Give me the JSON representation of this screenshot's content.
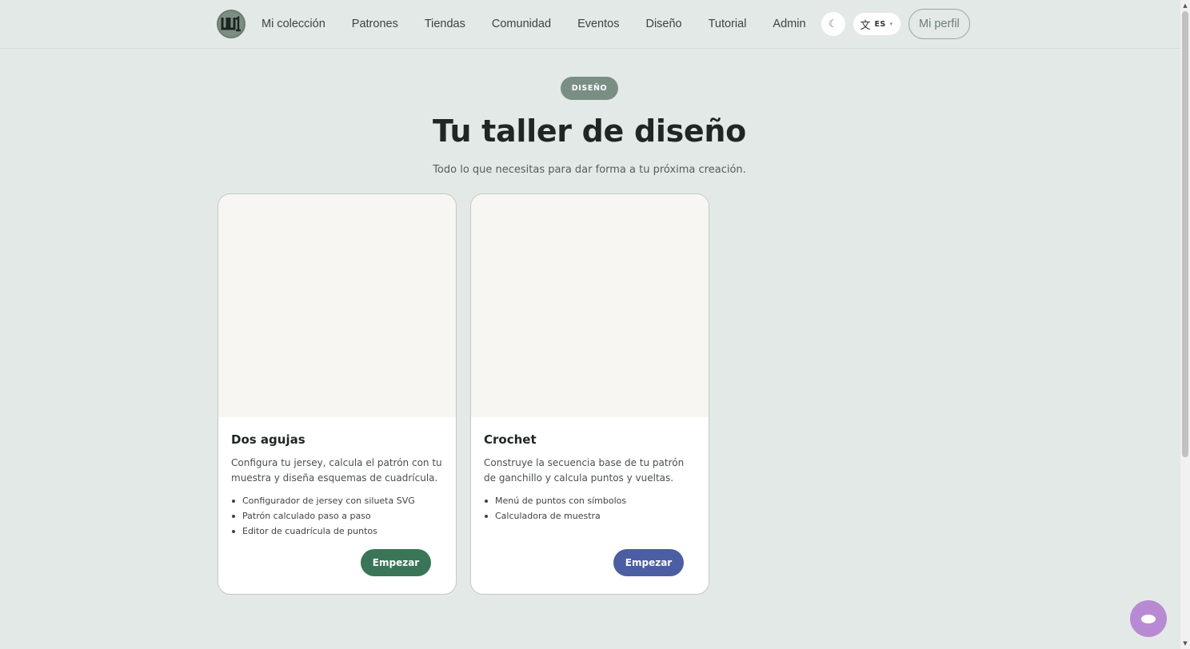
{
  "header": {
    "logo_icon": "yarn-logo-icon",
    "nav": [
      {
        "label": "Mi colección"
      },
      {
        "label": "Patrones"
      },
      {
        "label": "Tiendas"
      },
      {
        "label": "Comunidad"
      },
      {
        "label": "Eventos"
      },
      {
        "label": "Diseño"
      },
      {
        "label": "Tutorial"
      },
      {
        "label": "Admin"
      }
    ],
    "theme_icon": "moon-icon",
    "theme_glyph": "☾",
    "language": {
      "globe_glyph": "文",
      "code": "ES",
      "caret": "▾"
    },
    "profile_label": "Mi perfil"
  },
  "hero": {
    "badge": "DISEÑO",
    "title": "Tu taller de diseño",
    "subtitle": "Todo lo que necesitas para dar forma a tu próxima creación."
  },
  "cards": [
    {
      "title": "Dos agujas",
      "description": "Configura tu jersey, calcula el patrón con tu muestra y diseña esquemas de cuadrícula.",
      "features": [
        "Configurador de jersey con silueta SVG",
        "Patrón calculado paso a paso",
        "Editor de cuadrícula de puntos"
      ],
      "button_label": "Empezar",
      "button_color": "#3a7558"
    },
    {
      "title": "Crochet",
      "description": "Construye la secuencia base de tu patrón de ganchillo y calcula puntos y vueltas.",
      "features": [
        "Menú de puntos con símbolos",
        "Calculadora de muestra"
      ],
      "button_label": "Empezar",
      "button_color": "#4b5ea4"
    }
  ],
  "colors": {
    "background": "#e3e9e6",
    "badge": "#7a8f84",
    "chat_button": "#b98ad4"
  },
  "chat": {
    "icon": "chat-bubble-icon"
  }
}
